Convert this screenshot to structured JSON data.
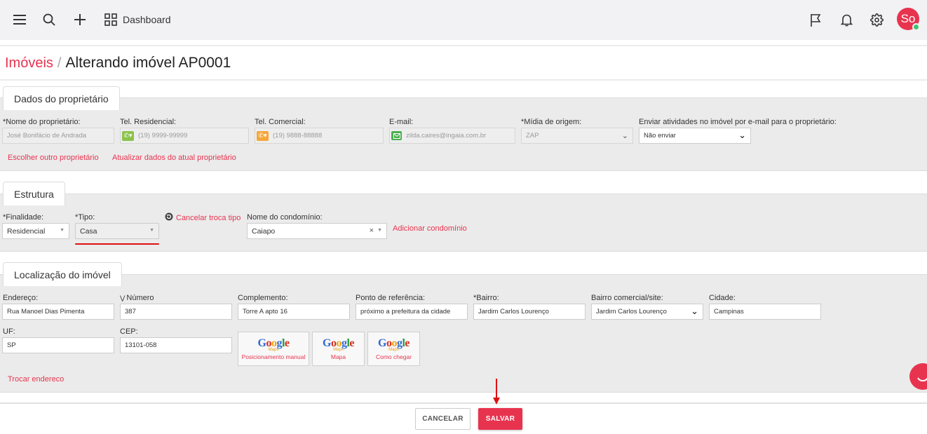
{
  "topbar": {
    "dashboard_label": "Dashboard",
    "avatar_initials": "So",
    "icons": [
      "menu-icon",
      "search-icon",
      "plus-icon",
      "dashboard-grid-icon",
      "flag-icon",
      "bell-icon",
      "gear-icon"
    ]
  },
  "breadcrumb": {
    "parent": "Imóveis",
    "separator": "/",
    "current": "Alterando imóvel AP0001"
  },
  "owner": {
    "tab": "Dados do proprietário",
    "name_label": "*Nome do proprietário:",
    "name_value": "José Bonifácio de Andrada",
    "tel_res_label": "Tel. Residencial:",
    "tel_res_placeholder": "(19) 9999-99999",
    "tel_com_label": "Tel. Comercial:",
    "tel_com_placeholder": "(19) 9888-88888",
    "email_label": "E-mail:",
    "email_value": "zilda.caires@ingaia.com.br",
    "media_label": "*Mídia de origem:",
    "media_value": "ZAP",
    "send_label": "Enviar atividades no imóvel por e-mail para o proprietário:",
    "send_value": "Não enviar",
    "choose_other": "Escolher outro proprietário",
    "update_data": "Atualizar dados do atual proprietário"
  },
  "structure": {
    "tab": "Estrutura",
    "purpose_label": "*Finalidade:",
    "purpose_value": "Residencial",
    "type_label": "*Tipo:",
    "type_value": "Casa",
    "cancel_type": "Cancelar troca tipo",
    "condo_label": "Nome do condomínio:",
    "condo_value": "Caiapo",
    "add_condo": "Adicionar condomínio"
  },
  "location": {
    "tab": "Localização do imóvel",
    "address_label": "Endereço:",
    "address_value": "Rua Manoel Dias Pimenta",
    "number_label": "Número",
    "number_value": "387",
    "complement_label": "Complemento:",
    "complement_value": "Torre A apto 16",
    "reference_label": "Ponto de referência:",
    "reference_value": "próximo a prefeitura da cidade",
    "district_label": "*Bairro:",
    "district_value": "Jardim Carlos Lourenço",
    "comm_district_label": "Bairro comercial/site:",
    "comm_district_value": "Jardim Carlos Lourenço",
    "city_label": "Cidade:",
    "city_value": "Campinas",
    "uf_label": "UF:",
    "uf_value": "SP",
    "cep_label": "CEP:",
    "cep_value": "13101-058",
    "google_buttons": [
      {
        "logo_sub": "Maps",
        "label": "Posicionamento manual"
      },
      {
        "logo_sub": "Maps",
        "label": "Mapa"
      },
      {
        "logo_sub": "Maps",
        "label": "Como chegar"
      }
    ],
    "change_address": "Trocar endereco"
  },
  "footer": {
    "cancel": "CANCELAR",
    "save": "SALVAR"
  },
  "colors": {
    "accent": "#e8334f",
    "section_bg": "#ebebeb"
  }
}
